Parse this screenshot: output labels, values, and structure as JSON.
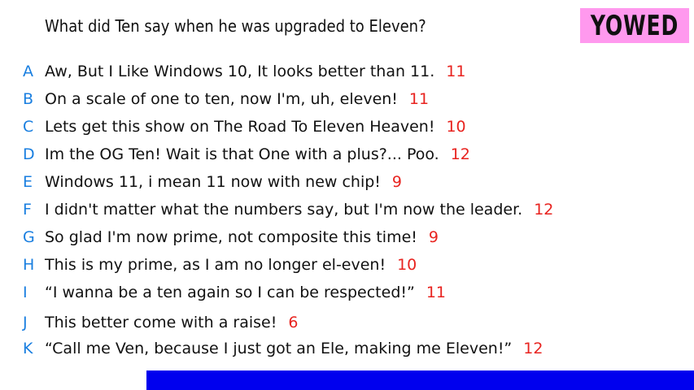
{
  "question": "What did Ten say when he was upgraded to Eleven?",
  "badge": {
    "label": "YOWED",
    "color": "#ff99ee"
  },
  "colors": {
    "letter": "#1a7fe0",
    "score": "#e8231f",
    "bar": "#0000ee"
  },
  "answers": [
    {
      "letter": "A",
      "text": "Aw, But I Like Windows 10, It looks better than 11.",
      "score": "11"
    },
    {
      "letter": "B",
      "text": "On a scale of one to ten, now I'm, uh, eleven!",
      "score": "11"
    },
    {
      "letter": "C",
      "text": "Lets get this show on The Road To Eleven Heaven!",
      "score": "10"
    },
    {
      "letter": "D",
      "text": "Im the OG Ten! Wait is that One with a plus?... Poo.",
      "score": "12"
    },
    {
      "letter": "E",
      "text": "Windows 11, i mean 11 now with new chip!",
      "score": "9"
    },
    {
      "letter": "F",
      "text": "I didn't matter what the numbers say, but I'm now the leader.",
      "score": "12"
    },
    {
      "letter": "G",
      "text": "So glad I'm now prime, not composite this time!",
      "score": "9"
    },
    {
      "letter": "H",
      "text": "This is my prime, as I am no longer el-even!",
      "score": "10"
    },
    {
      "letter": "I",
      "text": "“I wanna be a ten again so I can be respected!”",
      "score": "11"
    },
    {
      "letter": "J",
      "text": "This better come with a raise!",
      "score": "6"
    },
    {
      "letter": "K",
      "text": "“Call me Ven, because I just got an Ele, making me Eleven!”",
      "score": "12"
    }
  ]
}
